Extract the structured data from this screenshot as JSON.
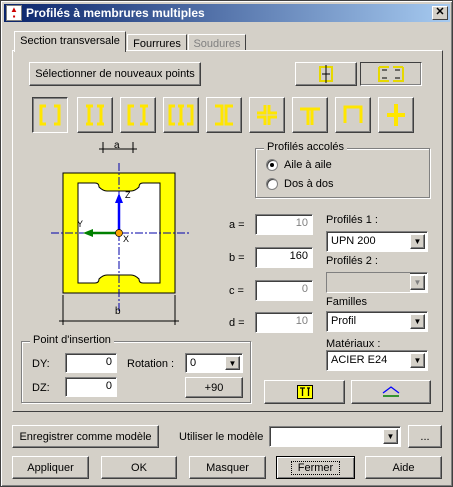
{
  "window": {
    "title": "Profilés à membrures multiples",
    "close_glyph": "✕"
  },
  "tabs": [
    {
      "label": "Section transversale",
      "active": true
    },
    {
      "label": "Fourrures",
      "active": false
    },
    {
      "label": "Soudures",
      "active": false,
      "disabled": true
    }
  ],
  "select_points_button": "Sélectionner de nouveaux points",
  "orientation_buttons": [
    {
      "icon": "single-channel-icon",
      "selected": false
    },
    {
      "icon": "double-channel-icon",
      "selected": true
    }
  ],
  "shape_buttons": [
    {
      "icon": "channels-face-to-face-icon"
    },
    {
      "icon": "i-beams-icon"
    },
    {
      "icon": "channel-i-icon"
    },
    {
      "icon": "channel-i-channel-icon"
    },
    {
      "icon": "channels-back-to-back-icon"
    },
    {
      "icon": "cross-angles-icon"
    },
    {
      "icon": "tee-icon"
    },
    {
      "icon": "angle-corner-icon"
    },
    {
      "icon": "cross-tee-icon"
    }
  ],
  "diagram": {
    "dim_a": "a",
    "dim_b": "b",
    "axis_z": "Z",
    "axis_y": "Y",
    "axis_x": "X",
    "accent": "#ffff00"
  },
  "profiles_accoles": {
    "legend": "Profilés accolés",
    "options": [
      {
        "label": "Aile à aile",
        "selected": true
      },
      {
        "label": "Dos à dos",
        "selected": false
      }
    ]
  },
  "dimensions": [
    {
      "label": "a =",
      "value": "10",
      "disabled": true
    },
    {
      "label": "b =",
      "value": "160",
      "disabled": false
    },
    {
      "label": "c =",
      "value": "0",
      "disabled": true
    },
    {
      "label": "d =",
      "value": "10",
      "disabled": true
    }
  ],
  "profils1": {
    "label": "Profilés 1 :",
    "value": "UPN 200"
  },
  "profils2": {
    "label": "Profilés 2 :",
    "value": ""
  },
  "familles": {
    "label": "Familles",
    "value": "Profil"
  },
  "materiaux": {
    "label": "Matériaux :",
    "value": "ACIER E24"
  },
  "insertion": {
    "legend": "Point d'insertion",
    "dy_label": "DY:",
    "dy_value": "0",
    "dz_label": "DZ:",
    "dz_value": "0",
    "rotation_label": "Rotation :",
    "rotation_value": "0",
    "plus90_button": "+90"
  },
  "icon_buttons": [
    {
      "icon": "properties-table-icon"
    },
    {
      "icon": "section-view-icon"
    }
  ],
  "model": {
    "save_button": "Enregistrer comme modèle",
    "use_label": "Utiliser le modèle",
    "value": "",
    "browse_button": "..."
  },
  "footer": {
    "apply": "Appliquer",
    "ok": "OK",
    "hide": "Masquer",
    "close": "Fermer",
    "help": "Aide"
  }
}
